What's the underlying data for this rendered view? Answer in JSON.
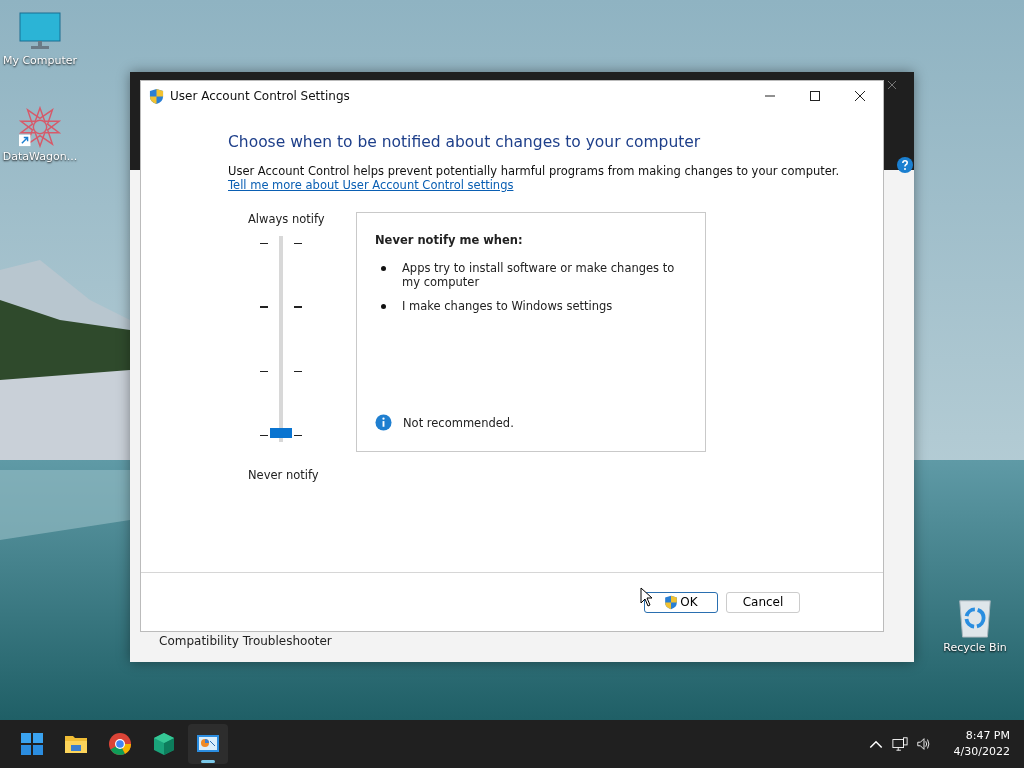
{
  "desktop_icons": [
    {
      "label": "My Computer",
      "kind": "computer"
    },
    {
      "label": "DataWagon...",
      "kind": "shortcut"
    },
    {
      "label": "Recycle Bin",
      "kind": "recycle-bin"
    }
  ],
  "background_window": {
    "visible_text": "Compatibility Troubleshooter"
  },
  "dialog": {
    "title": "User Account Control Settings",
    "heading": "Choose when to be notified about changes to your computer",
    "description": "User Account Control helps prevent potentially harmful programs from making changes to your computer.",
    "link": "Tell me more about User Account Control settings",
    "slider": {
      "top_label": "Always notify",
      "bottom_label": "Never notify",
      "level": 0
    },
    "info_panel": {
      "heading": "Never notify me when:",
      "bullets": [
        "Apps try to install software or make changes to my computer",
        "I make changes to Windows settings"
      ],
      "note": "Not recommended."
    },
    "buttons": [
      {
        "label": "OK",
        "kind": "shield",
        "focused": true
      },
      {
        "label": "Cancel",
        "kind": "plain",
        "focused": false
      }
    ]
  },
  "taskbar": {
    "apps": [
      {
        "kind": "start",
        "active": false
      },
      {
        "kind": "folder",
        "active": false
      },
      {
        "kind": "browser",
        "active": false
      },
      {
        "kind": "package",
        "active": false
      },
      {
        "kind": "control-panel",
        "active": true
      }
    ],
    "time": "8:47 PM",
    "date": "4/30/2022"
  }
}
